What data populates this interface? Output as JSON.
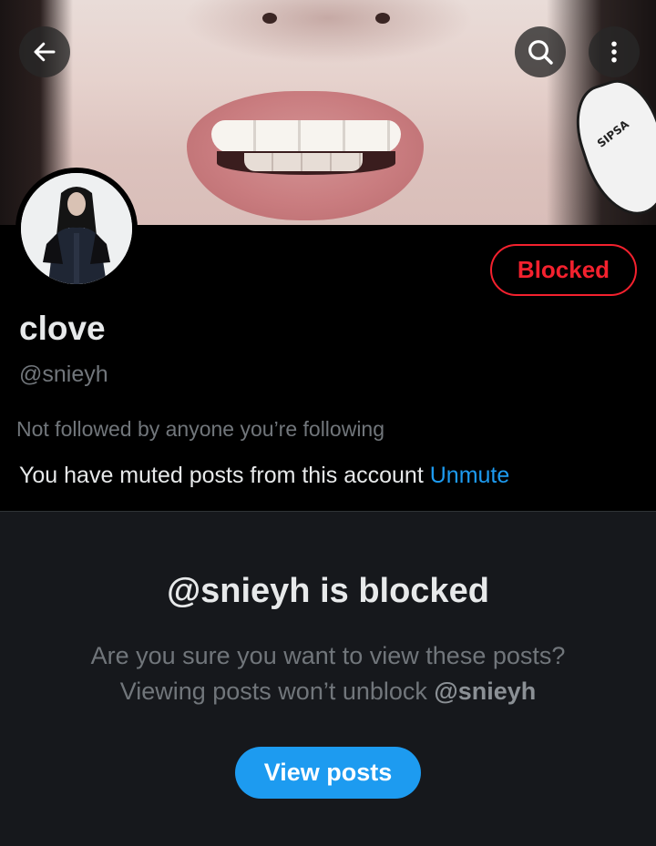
{
  "header": {
    "back_icon": "arrow-left-icon",
    "search_icon": "search-icon",
    "more_icon": "more-vertical-icon"
  },
  "banner": {
    "earring_text": "SIPSA"
  },
  "profile": {
    "display_name": "clove",
    "handle": "@snieyh",
    "blocked_label": "Blocked",
    "followers_note": "Not followed by anyone you’re following",
    "muted_text": "You have muted posts from this account",
    "unmute_label": "Unmute"
  },
  "blocked_panel": {
    "title": "@snieyh is blocked",
    "line1": "Are you sure you want to view these posts?",
    "line2_prefix": "Viewing posts won’t unblock ",
    "line2_handle": "@snieyh",
    "button_label": "View posts"
  },
  "colors": {
    "background": "#000000",
    "panel": "#16181c",
    "blocked_red": "#f4212e",
    "link_blue": "#1d9bf0",
    "secondary_text": "#71767b"
  }
}
